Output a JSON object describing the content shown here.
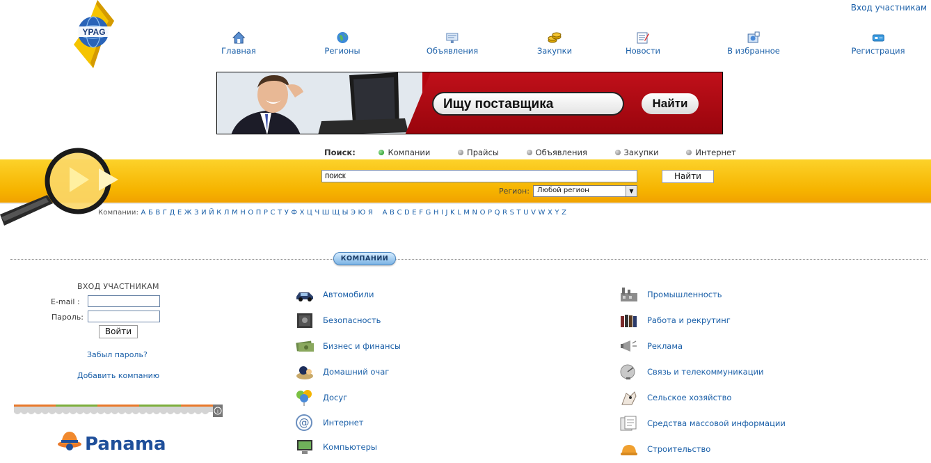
{
  "header": {
    "login_link": "Вход участникам",
    "logo_text": "YPAG"
  },
  "nav": [
    {
      "label": "Главная",
      "icon": "home-icon"
    },
    {
      "label": "Регионы",
      "icon": "globe-icon"
    },
    {
      "label": "Объявления",
      "icon": "announcements-icon"
    },
    {
      "label": "Закупки",
      "icon": "coins-icon"
    },
    {
      "label": "Новости",
      "icon": "news-icon"
    },
    {
      "label": "В избранное",
      "icon": "favorites-icon"
    },
    {
      "label": "Регистрация",
      "icon": "registration-icon"
    }
  ],
  "banner": {
    "field_text": "Ищу поставщика",
    "button_text": "Найти"
  },
  "search": {
    "label": "Поиск:",
    "options": [
      "Компании",
      "Прайсы",
      "Объявления",
      "Закупки",
      "Интернет"
    ],
    "active_option": "Компании",
    "query_value": "поиск",
    "button_label": "Найти",
    "region_label": "Регион:",
    "region_value": "Любой регион"
  },
  "alphabet": {
    "label": "Компании:",
    "cyrillic": "А Б В Г Д Е Ж З И Й К Л М Н О П Р С Т У Ф Х Ц Ч Ш Щ Ы Э Ю Я",
    "latin": "A B C D E F G H I J K L M N O P Q R S T U V W X Y Z"
  },
  "section_title": "КОМПАНИИ",
  "login_form": {
    "title": "ВХОД УЧАСТНИКАМ",
    "email_label": "E-mail  :",
    "password_label": "Пароль:",
    "submit_label": "Войти",
    "forgot_link": "Забыл пароль?",
    "add_company_link": "Добавить компанию"
  },
  "partner": {
    "name": "Panama"
  },
  "categories_left": [
    {
      "label": "Автомобили",
      "icon": "car-icon"
    },
    {
      "label": "Безопасность",
      "icon": "safe-icon"
    },
    {
      "label": "Бизнес и финансы",
      "icon": "money-icon"
    },
    {
      "label": "Домашний очаг",
      "icon": "home-hearth-icon"
    },
    {
      "label": "Досуг",
      "icon": "balloons-icon"
    },
    {
      "label": "Интернет",
      "icon": "at-sign-icon"
    },
    {
      "label": "Компьютеры",
      "icon": "computer-icon"
    }
  ],
  "categories_right": [
    {
      "label": "Промышленность",
      "icon": "factory-icon"
    },
    {
      "label": "Работа и рекрутинг",
      "icon": "people-icon"
    },
    {
      "label": "Реклама",
      "icon": "megaphone-icon"
    },
    {
      "label": "Связь и телекоммуникации",
      "icon": "satellite-dish-icon"
    },
    {
      "label": "Сельское хозяйство",
      "icon": "farm-icon"
    },
    {
      "label": "Средства массовой информации",
      "icon": "newspapers-icon"
    },
    {
      "label": "Строительство",
      "icon": "hardhat-icon"
    }
  ],
  "colors": {
    "link": "#1a5fa8",
    "yellow_bar": "#f6b400",
    "banner_red": "#b5050f"
  }
}
